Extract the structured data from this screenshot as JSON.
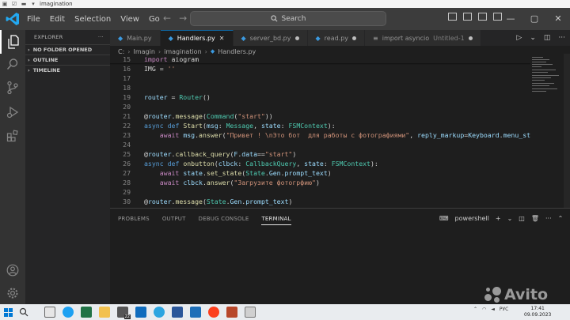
{
  "window": {
    "caption_title": "imagination"
  },
  "menu": {
    "items": [
      "File",
      "Edit",
      "Selection",
      "View",
      "Go"
    ]
  },
  "search": {
    "label": "Search"
  },
  "sidebar": {
    "title": "EXPLORER",
    "more": "···",
    "sections": [
      {
        "label": "NO FOLDER OPENED"
      },
      {
        "label": "OUTLINE"
      },
      {
        "label": "TIMELINE"
      }
    ]
  },
  "tabs": [
    {
      "label": "Main.py",
      "active": false,
      "status": "none"
    },
    {
      "label": "Handlers.py",
      "active": true,
      "status": "close"
    },
    {
      "label": "server_bd.py",
      "active": false,
      "status": "dot"
    },
    {
      "label": "read.py",
      "active": false,
      "status": "dot"
    },
    {
      "label": "import asyncio",
      "sublabel": "Untitled-1",
      "active": false,
      "status": "dot"
    }
  ],
  "breadcrumb": [
    "C:",
    "Imagin",
    "imagination",
    "Handlers.py"
  ],
  "code": {
    "lines": [
      {
        "n": "15",
        "html": "<span class=\"kw2\">import</span> aiogram"
      },
      {
        "n": "16",
        "html": "IMG = <span class=\"str\">''</span>"
      },
      {
        "n": "17",
        "html": ""
      },
      {
        "n": "18",
        "html": ""
      },
      {
        "n": "19",
        "html": "<span class=\"var\">router</span> = <span class=\"cls\">Router</span>()"
      },
      {
        "n": "20",
        "html": ""
      },
      {
        "n": "21",
        "html": "@<span class=\"var\">router</span>.<span class=\"fn\">message</span>(<span class=\"cls\">Command</span>(<span class=\"str\">\"start\"</span>))"
      },
      {
        "n": "22",
        "html": "<span class=\"kw\">async</span> <span class=\"kw\">def</span> <span class=\"fn\">Start</span>(<span class=\"var\">msg</span>: <span class=\"cls\">Message</span>, <span class=\"var\">state</span>: <span class=\"cls\">FSMContext</span>):"
      },
      {
        "n": "23",
        "html": "    <span class=\"kw2\">await</span> <span class=\"var\">msg</span>.<span class=\"fn\">answer</span>(<span class=\"str\">\"Привет ! \\nЭто бот  для работы с фотографиями\"</span>, <span class=\"var\">reply_markup</span>=<span class=\"var\">Keyboard</span>.<span class=\"var\">menu_st</span>"
      },
      {
        "n": "24",
        "html": ""
      },
      {
        "n": "25",
        "html": "@<span class=\"var\">router</span>.<span class=\"fn\">callback_query</span>(<span class=\"var\">F</span>.<span class=\"var\">data</span>==<span class=\"str\">\"start\"</span>)"
      },
      {
        "n": "26",
        "html": "<span class=\"kw\">async</span> <span class=\"kw\">def</span> <span class=\"fn\">onbutton</span>(<span class=\"var\">clbck</span>: <span class=\"cls\">CallbackQuery</span>, <span class=\"var\">state</span>: <span class=\"cls\">FSMContext</span>):"
      },
      {
        "n": "27",
        "html": "    <span class=\"kw2\">await</span> <span class=\"var\">state</span>.<span class=\"fn\">set_state</span>(<span class=\"cls\">State</span>.<span class=\"var\">Gen</span>.<span class=\"var\">prompt_text</span>)"
      },
      {
        "n": "28",
        "html": "    <span class=\"kw2\">await</span> <span class=\"var\">clbck</span>.<span class=\"fn\">answer</span>(<span class=\"str\">\"Загрузите фотогрфию\"</span>)"
      },
      {
        "n": "29",
        "html": ""
      },
      {
        "n": "30",
        "html": "@<span class=\"var\">router</span>.<span class=\"fn\">message</span>(<span class=\"cls\">State</span>.<span class=\"var\">Gen</span>.<span class=\"var\">prompt_text</span>)"
      }
    ]
  },
  "panel": {
    "tabs": [
      {
        "label": "PROBLEMS",
        "active": false
      },
      {
        "label": "OUTPUT",
        "active": false
      },
      {
        "label": "DEBUG CONSOLE",
        "active": false
      },
      {
        "label": "TERMINAL",
        "active": true
      }
    ],
    "terminal_name": "powershell"
  },
  "taskbar": {
    "badge_count": "22",
    "language": "РУС",
    "time": "17:41",
    "date": "09.09.2023"
  },
  "watermark": {
    "text": "Avito"
  },
  "colors": {
    "accent": "#007acc",
    "editor_bg": "#1e1e1e",
    "sidebar_bg": "#252526",
    "activity_bg": "#333333"
  }
}
